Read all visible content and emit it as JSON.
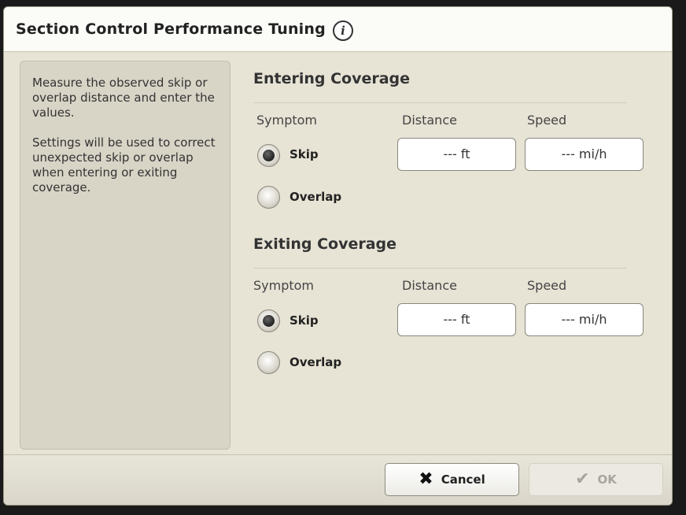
{
  "dialog": {
    "title": "Section Control Performance Tuning",
    "info_icon": "i"
  },
  "help": {
    "paragraph1": "Measure the observed skip or overlap distance and enter the values.",
    "paragraph2": "Settings will be used to correct unexpected skip or overlap when entering or exiting coverage."
  },
  "entering": {
    "title": "Entering Coverage",
    "symptom_header": "Symptom",
    "distance_header": "Distance",
    "speed_header": "Speed",
    "options": [
      "Skip",
      "Overlap"
    ],
    "selected": "Skip",
    "distance_value": "--- ft",
    "speed_value": "--- mi/h"
  },
  "exiting": {
    "title": "Exiting Coverage",
    "symptom_header": "Symptom",
    "distance_header": "Distance",
    "speed_header": "Speed",
    "options": [
      "Skip",
      "Overlap"
    ],
    "selected": "Skip",
    "distance_value": "--- ft",
    "speed_value": "--- mi/h"
  },
  "footer": {
    "cancel_label": "Cancel",
    "cancel_icon": "x-icon",
    "ok_label": "OK",
    "ok_icon": "checkmark-icon",
    "ok_enabled": false
  }
}
